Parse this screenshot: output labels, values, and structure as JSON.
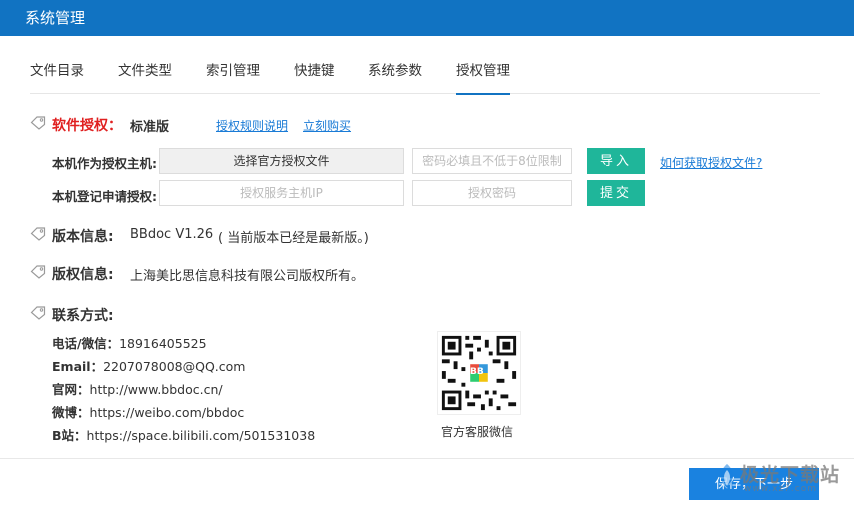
{
  "window": {
    "title": "系统管理"
  },
  "tabs": [
    {
      "label": "文件目录"
    },
    {
      "label": "文件类型"
    },
    {
      "label": "索引管理"
    },
    {
      "label": "快捷键"
    },
    {
      "label": "系统参数"
    },
    {
      "label": "授权管理",
      "active": true
    }
  ],
  "license": {
    "label": "软件授权：",
    "edition": "标准版",
    "rules_link": "授权规则说明",
    "buy_link": "立刻购买",
    "host_label": "本机作为授权主机:",
    "select_file_button": "选择官方授权文件",
    "password_placeholder": "密码必填且不低于8位限制",
    "import_button": "导入",
    "how_to_link": "如何获取授权文件?",
    "register_label": "本机登记申请授权:",
    "host_ip_placeholder": "授权服务主机IP",
    "auth_password_placeholder": "授权密码",
    "submit_button": "提交"
  },
  "version": {
    "label": "版本信息:",
    "value": "BBdoc V1.26",
    "note": "( 当前版本已经是最新版。)"
  },
  "copyright": {
    "label": "版权信息:",
    "value": "上海美比思信息科技有限公司版权所有。"
  },
  "contact": {
    "label": "联系方式:",
    "rows": [
      {
        "key": "电话/微信：",
        "value": "18916405525"
      },
      {
        "key": "Email：",
        "value": "2207078008@QQ.com"
      },
      {
        "key": "官网：",
        "value": "http://www.bbdoc.cn/"
      },
      {
        "key": "微博：",
        "value": "https://weibo.com/bbdoc"
      },
      {
        "key": "B站：",
        "value": "https://space.bilibili.com/501531038"
      }
    ],
    "qr_caption": "官方客服微信",
    "qr_logo_text": "BB"
  },
  "footer": {
    "save_button": "保存，下一步"
  },
  "watermark": {
    "text": "极光下载站",
    "sub": "www.xz7.com"
  },
  "colors": {
    "titlebar": "#1173c2",
    "accent_green": "#1fb69a",
    "link": "#1a7bd6",
    "primary": "#1a82e0",
    "warning_red": "#e02020"
  }
}
